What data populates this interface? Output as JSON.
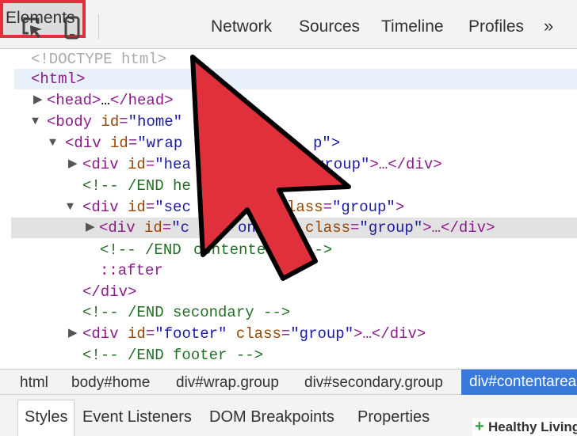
{
  "toolbar": {
    "icons": [
      "inspect-cursor-icon",
      "mobile-device-icon"
    ],
    "tabs": [
      {
        "label": "Elements",
        "active": true
      },
      {
        "label": "Network"
      },
      {
        "label": "Sources"
      },
      {
        "label": "Timeline"
      },
      {
        "label": "Profiles"
      }
    ],
    "more": "»"
  },
  "tree": {
    "doctype": "<!DOCTYPE html>",
    "html_tag": "<html>",
    "head": {
      "open": "<head>",
      "ellipsis": "…",
      "close": "</head>"
    },
    "body": {
      "open_a": "<body ",
      "attr": "id",
      "eq": "=",
      "val": "\"home\""
    },
    "wrap": {
      "open_a": "<div ",
      "attr": "id",
      "eq": "=",
      "val": "\"wrap",
      "close": "p\">"
    },
    "header": {
      "open_a": "<div ",
      "attr": "id",
      "eq": "=",
      "val": "\"hea",
      "rest_val": "group\"",
      "rest": ">…</div>"
    },
    "comment_header": "<!-- /END he",
    "secondary": {
      "open_a": "<div ",
      "attr": "id",
      "eq": "=",
      "val": "\"sec",
      "rest_attr": "lass",
      "rest_val": "\"group\"",
      "rest": ">"
    },
    "content": {
      "open_a": "<div ",
      "attr": "id",
      "eq": "=",
      "val": "\"c",
      "mid_val": "ontent",
      "class_attr": "class",
      "class_val": "\"group\"",
      "rest": ">…</div>"
    },
    "comment_content_a": "<!-- /END ",
    "comment_content_b": "contente",
    "comment_content_c": "-->",
    "after": "::after",
    "div_close": "</div>",
    "comment_secondary": "<!-- /END secondary -->",
    "footer": {
      "open_a": "<div ",
      "attr": "id",
      "eq": "=",
      "val": "\"footer\"",
      "class_attr": "class",
      "class_val": "\"group\"",
      "rest": ">…</div>"
    },
    "comment_footer": "<!-- /END footer -->"
  },
  "breadcrumbs": [
    "html",
    "body#home",
    "div#wrap.group",
    "div#secondary.group",
    "div#contentarea"
  ],
  "subtabs": [
    "Styles",
    "Event Listeners",
    "DOM Breakpoints",
    "Properties"
  ],
  "watermark": {
    "plus": "+",
    "text": "Healthy Living"
  },
  "colors": {
    "highlight_border": "#e0303b",
    "arrow_fill": "#e0303b",
    "crumb_active": "#3879d9"
  }
}
